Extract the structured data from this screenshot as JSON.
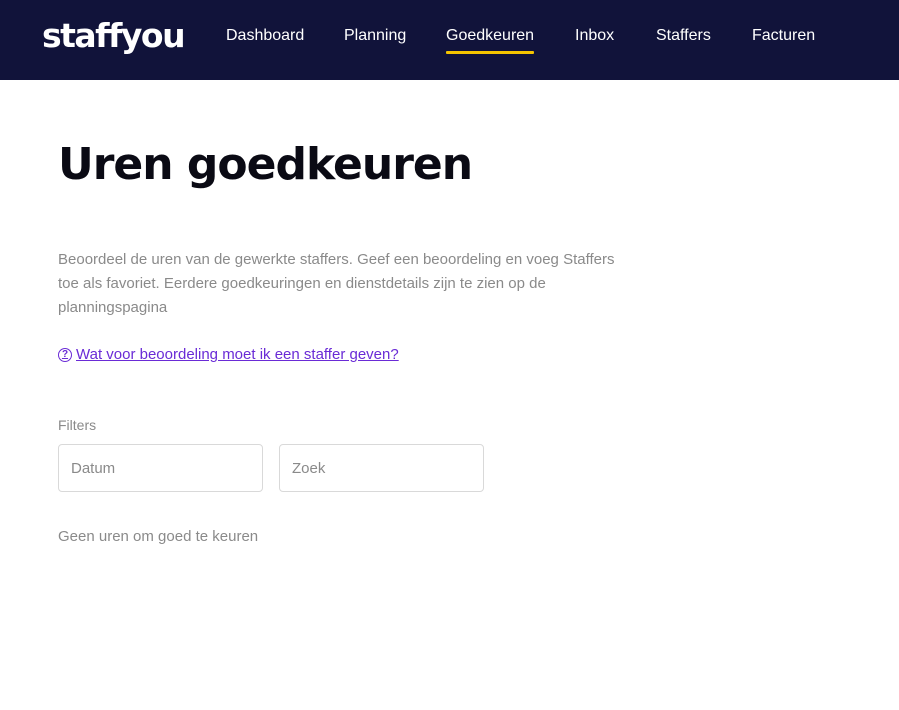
{
  "header": {
    "logo_text": "staffyou",
    "nav": [
      {
        "label": "Dashboard",
        "active": false
      },
      {
        "label": "Planning",
        "active": false
      },
      {
        "label": "Goedkeuren",
        "active": true
      },
      {
        "label": "Inbox",
        "active": false
      },
      {
        "label": "Staffers",
        "active": false
      },
      {
        "label": "Facturen",
        "active": false
      }
    ]
  },
  "main": {
    "title": "Uren goedkeuren",
    "description": "Beoordeel de uren van de gewerkte staffers. Geef een beoordeling en voeg Staffers toe als favoriet. Eerdere goedkeuringen en dienstdetails zijn te zien op de planningspagina",
    "help_link": "Wat voor beoordeling moet ik een staffer geven?",
    "help_icon": "question-circle-icon",
    "filters": {
      "label": "Filters",
      "date_placeholder": "Datum",
      "search_placeholder": "Zoek"
    },
    "empty_state": "Geen uren om goed te keuren"
  },
  "colors": {
    "navbar_bg": "#11133a",
    "active_underline": "#f5c400",
    "link": "#6a2bd6",
    "muted_text": "#8a8a8a"
  }
}
